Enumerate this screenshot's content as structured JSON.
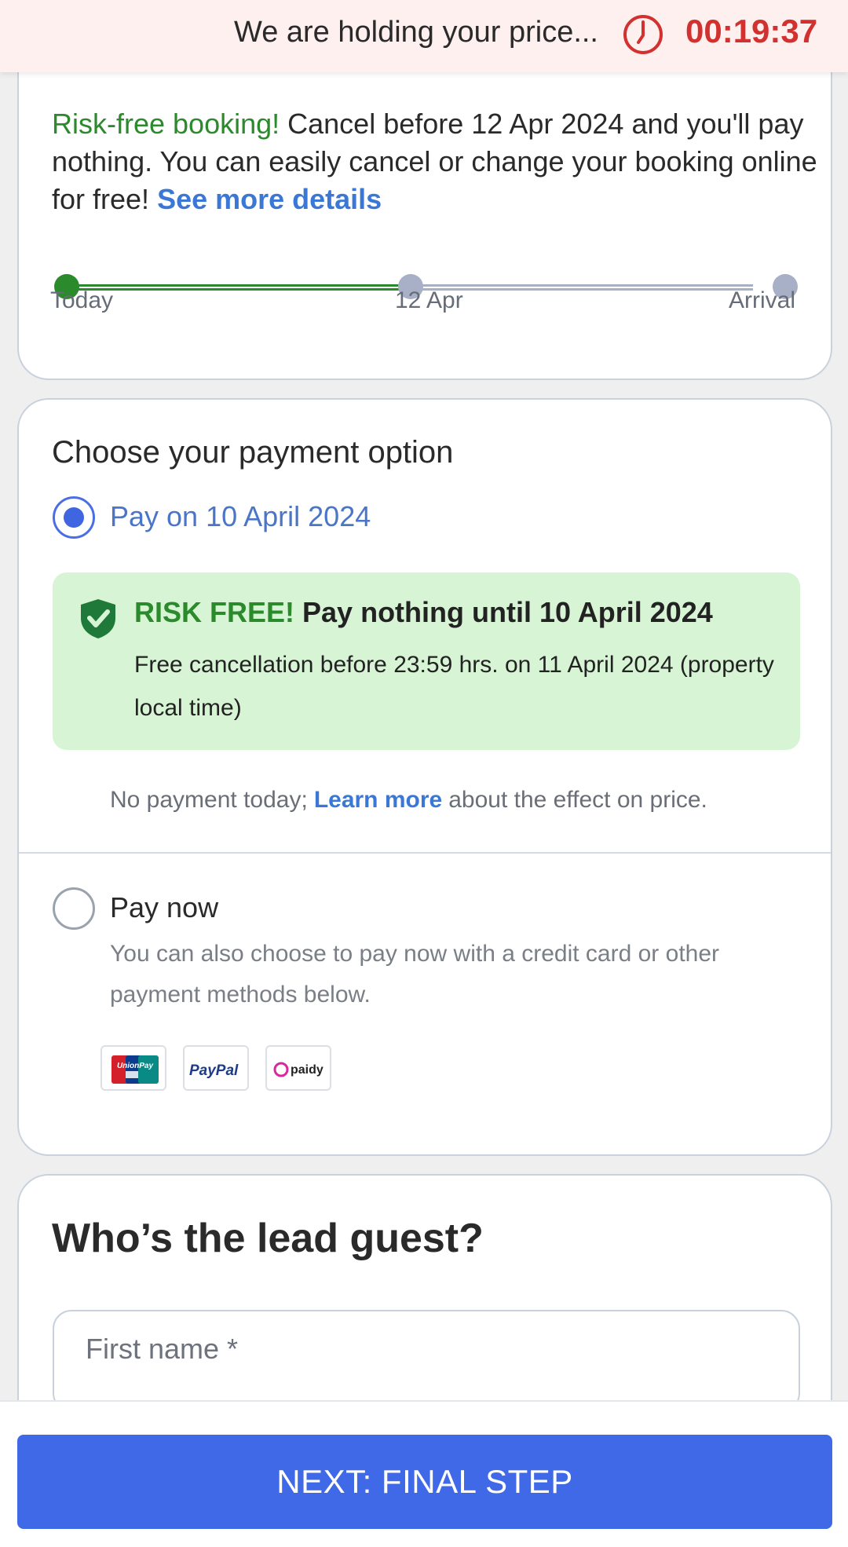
{
  "timer": {
    "text": "We are holding your price...",
    "value": "00:19:37",
    "icon": "clock-icon",
    "color": "#d33030"
  },
  "risk_free": {
    "highlight": "Risk-free booking!",
    "text": " Cancel before 12 Apr 2024 and you'll pay nothing. You can easily cancel or change your booking online for free!",
    "link": "See more details",
    "timeline": {
      "labels": [
        "Today",
        "12 Apr",
        "Arrival"
      ],
      "colors": {
        "done": "#2b8a2b",
        "pending": "#a7b0c6"
      }
    }
  },
  "payment": {
    "title": "Choose your payment option",
    "option_later": {
      "label": "Pay on 10 April 2024",
      "selected": true
    },
    "risk_box": {
      "badge": "RISK FREE!",
      "title": " Pay nothing until 10 April 2024",
      "body": "Free cancellation before 23:59 hrs. on 11 April 2024 (property local time)",
      "icon": "shield-check-icon"
    },
    "note": {
      "before": "No payment today;",
      "link": "Learn more",
      "after": "about the effect on price."
    },
    "option_now": {
      "label": "Pay now",
      "selected": false,
      "description": "You can also choose to pay now with a credit card or other payment methods below."
    },
    "methods": [
      "UnionPay",
      "PayPal",
      "paidy"
    ]
  },
  "guest": {
    "title": "Who’s the lead guest?",
    "first_name_placeholder": "First name *"
  },
  "footer": {
    "next_label": "NEXT: FINAL STEP",
    "color": "#3f69e6"
  }
}
